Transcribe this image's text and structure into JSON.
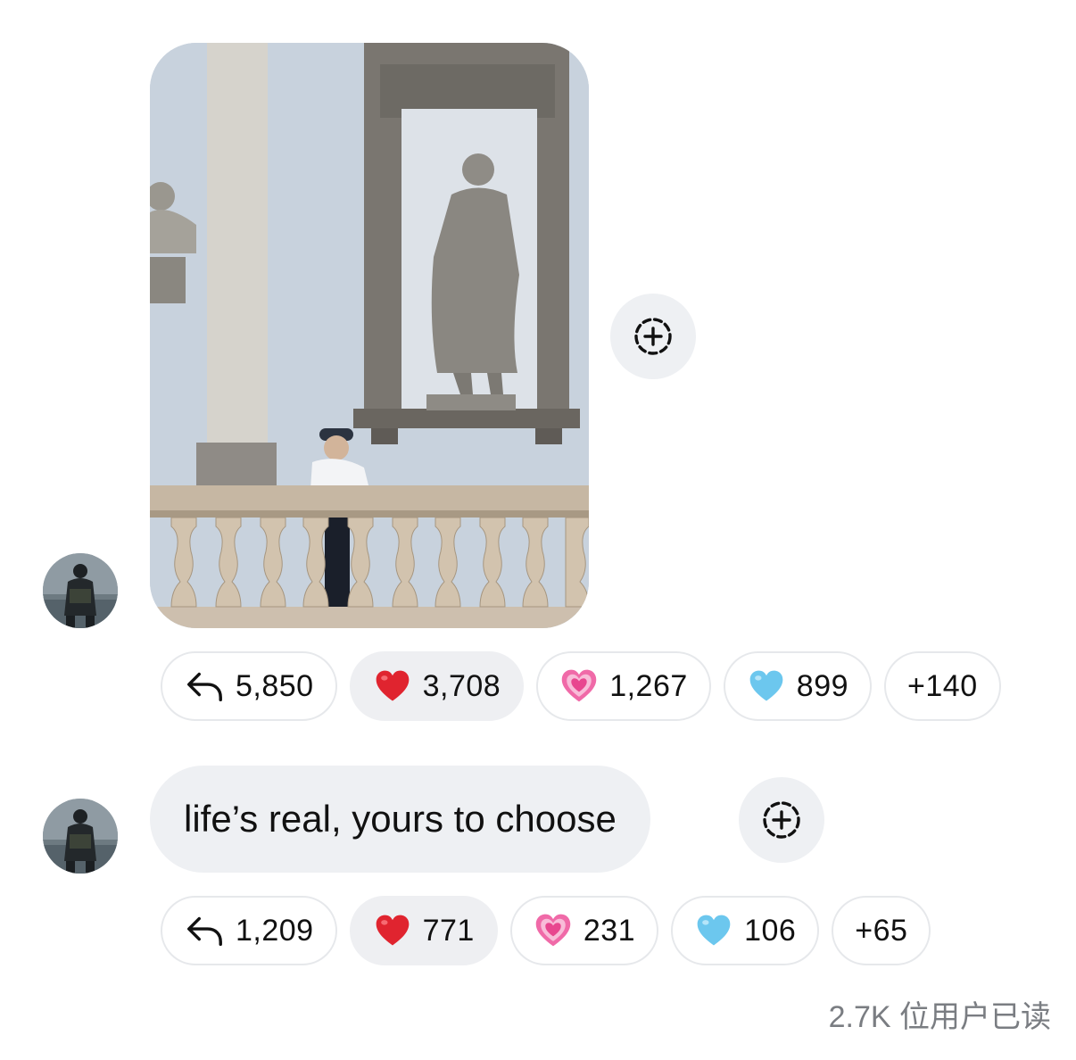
{
  "messages": [
    {
      "type": "image",
      "image_alt": "Person leaning on a stone balustrade below a statue in a wall niche",
      "reply_count": "5,850",
      "reactions": [
        {
          "icon": "red-heart-icon",
          "count": "3,708",
          "active": true
        },
        {
          "icon": "pink-sparkling-heart-icon",
          "count": "1,267",
          "active": false
        },
        {
          "icon": "light-blue-heart-icon",
          "count": "899",
          "active": false
        }
      ],
      "more_reactions": "+140"
    },
    {
      "type": "text",
      "text": "life’s real, yours to choose",
      "reply_count": "1,209",
      "reactions": [
        {
          "icon": "red-heart-icon",
          "count": "771",
          "active": true
        },
        {
          "icon": "pink-sparkling-heart-icon",
          "count": "231",
          "active": false
        },
        {
          "icon": "light-blue-heart-icon",
          "count": "106",
          "active": false
        }
      ],
      "more_reactions": "+65"
    }
  ],
  "seen_by": "2.7K 位用户已读",
  "colors": {
    "bubble_bg": "#eef0f3",
    "pill_border": "#e6e8eb",
    "red_heart": "#e0242f",
    "pink_heart": "#f06aa8",
    "blue_heart": "#6cc7ee",
    "muted_text": "#7a7d82"
  }
}
